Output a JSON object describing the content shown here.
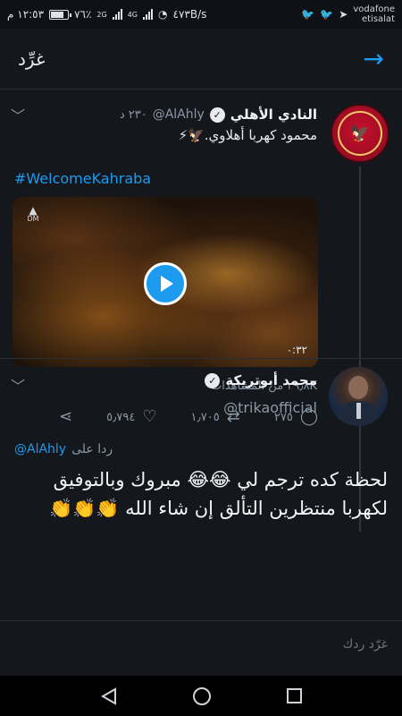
{
  "status_bar": {
    "time": "١٢:٥٣ م",
    "battery_percent": "٧٦٪",
    "network_2g": "2G",
    "network_4g": "4G",
    "speed": "٤٧٣B/s",
    "carrier_line1": "vodafone",
    "carrier_line2": "etisalat"
  },
  "header": {
    "title": "غرِّد",
    "back_icon": "arrow-right-icon"
  },
  "tweet": {
    "author_name": "النادي الأهلي",
    "author_handle": "@AlAhly",
    "time_ago": "٢٣٠ د",
    "text": "محمود كهربا أهلاوي.🦅⚡",
    "hashtag": "#WelcomeKahraba",
    "video_badge_top": "▲",
    "video_badge_bottom": "DM",
    "video_duration": "٠:٣٢",
    "views": "٢٩٫٨K من المشاهدات",
    "replies": "٢٧٥",
    "retweets": "١٫٧٠٥",
    "likes": "٥٫٧٩٤"
  },
  "reply": {
    "author_name": "محمد أبوتريكة",
    "author_handle": "@trikaofficial",
    "replying_label": "ردا على",
    "replying_to": "@AlAhly",
    "text": "لحظة كده ترجم لي 😂😂 مبروك وبالتوفيق لكهربا منتظرين التألق إن شاء الله 👏👏👏"
  },
  "compose": {
    "placeholder": "غرّد ردك"
  }
}
